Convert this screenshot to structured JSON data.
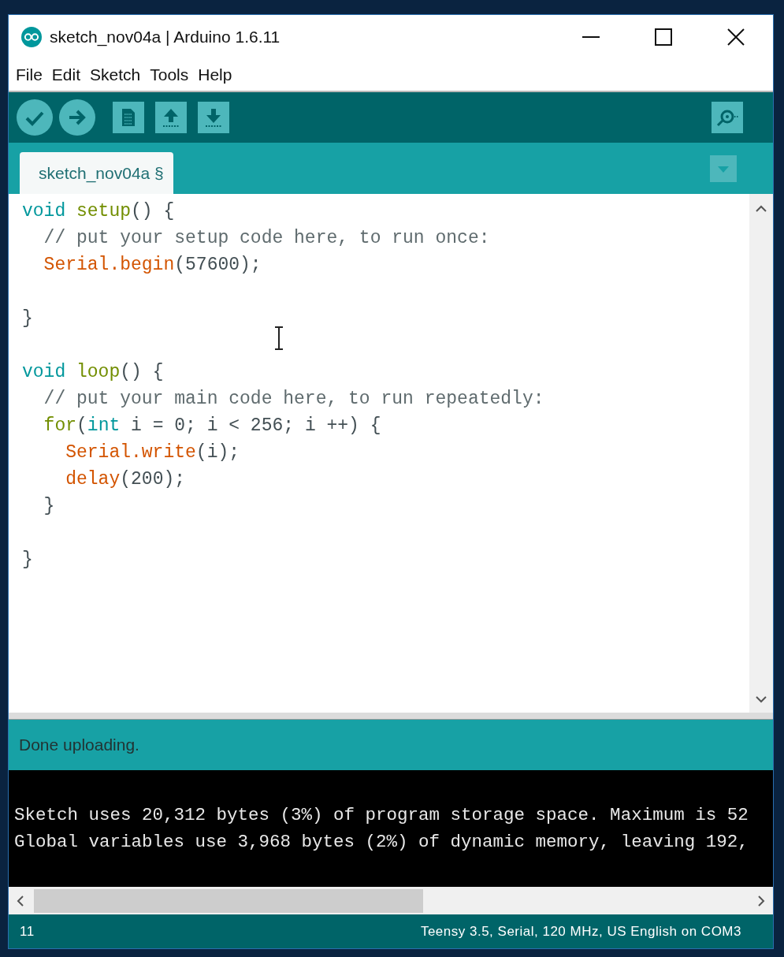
{
  "window": {
    "title": "sketch_nov04a | Arduino 1.6.11"
  },
  "menu": [
    {
      "label": "File"
    },
    {
      "label": "Edit"
    },
    {
      "label": "Sketch"
    },
    {
      "label": "Tools"
    },
    {
      "label": "Help"
    }
  ],
  "tabs": [
    {
      "label": "sketch_nov04a §",
      "selected": true
    }
  ],
  "editor": {
    "lines": [
      {
        "kind": "code",
        "tokens": [
          {
            "kind": "type",
            "text": "void"
          },
          {
            "kind": "space"
          },
          {
            "kind": "func",
            "text": "setup"
          },
          {
            "kind": "plain",
            "text": "() {"
          }
        ],
        "children": [
          {
            "kind": "code",
            "tokens": [
              {
                "kind": "comment",
                "text": "// put your setup code here, to run once:"
              }
            ]
          },
          {
            "kind": "code",
            "tokens": [
              {
                "kind": "lib",
                "text": "Serial.begin"
              },
              {
                "kind": "plain",
                "text": "(57600);"
              }
            ]
          },
          {
            "kind": "blank"
          }
        ]
      },
      {
        "kind": "code",
        "tokens": [
          {
            "kind": "plain",
            "text": "}"
          }
        ]
      },
      {
        "kind": "blank"
      },
      {
        "kind": "code",
        "tokens": [
          {
            "kind": "type",
            "text": "void"
          },
          {
            "kind": "space"
          },
          {
            "kind": "func",
            "text": "loop"
          },
          {
            "kind": "plain",
            "text": "() {"
          }
        ],
        "children": [
          {
            "kind": "code",
            "tokens": [
              {
                "kind": "comment",
                "text": "// put your main code here, to run repeatedly:"
              }
            ]
          },
          {
            "kind": "code",
            "tokens": [
              {
                "kind": "func",
                "text": "for"
              },
              {
                "kind": "plain",
                "text": "("
              },
              {
                "kind": "type",
                "text": "int"
              },
              {
                "kind": "space"
              },
              {
                "kind": "plain",
                "text": "i = 0; i < 256; i ++) {"
              }
            ],
            "children": [
              {
                "kind": "code",
                "tokens": [
                  {
                    "kind": "lib",
                    "text": "Serial.write"
                  },
                  {
                    "kind": "plain",
                    "text": "(i);"
                  }
                ]
              },
              {
                "kind": "code",
                "tokens": [
                  {
                    "kind": "lib",
                    "text": "delay"
                  },
                  {
                    "kind": "plain",
                    "text": "(200);"
                  }
                ]
              }
            ]
          },
          {
            "kind": "code",
            "tokens": [
              {
                "kind": "plain",
                "text": "}"
              }
            ]
          },
          {
            "kind": "blank"
          }
        ]
      },
      {
        "kind": "code",
        "tokens": [
          {
            "kind": "plain",
            "text": "}"
          }
        ]
      }
    ]
  },
  "status": {
    "message": "Done uploading."
  },
  "console": {
    "lines": [
      "Sketch uses 20,312 bytes (3%) of program storage space. Maximum is 52",
      "Global variables use 3,968 bytes (2%) of dynamic memory, leaving 192,"
    ]
  },
  "footer": {
    "line_number": "11",
    "board": "Teensy 3.5, Serial, 120 MHz, US English on COM3"
  }
}
